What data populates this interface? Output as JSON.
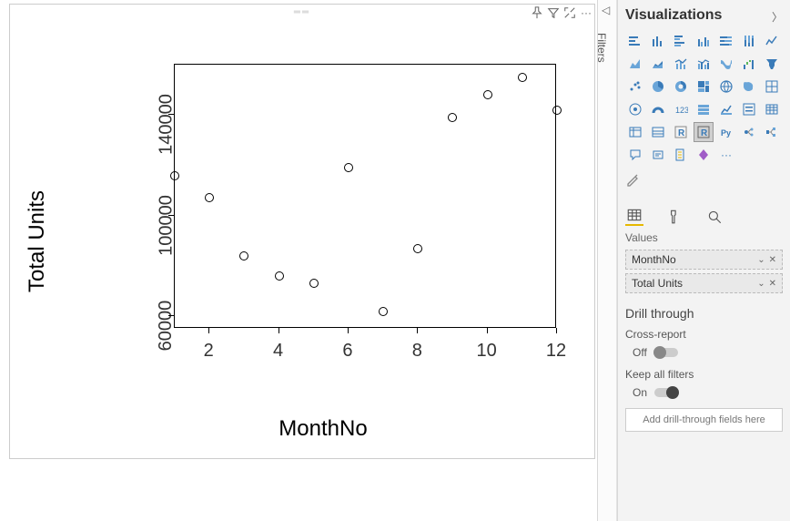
{
  "canvas": {
    "header_icons": [
      "pin-icon",
      "filter-icon",
      "focus-icon",
      "more-icon"
    ]
  },
  "filters_rail": {
    "label": "Filters"
  },
  "viz_pane": {
    "title": "Visualizations",
    "values_label": "Values",
    "fields": [
      {
        "name": "MonthNo"
      },
      {
        "name": "Total Units"
      }
    ],
    "drill": {
      "heading": "Drill through",
      "cross_label": "Cross-report",
      "cross_state": "Off",
      "keep_label": "Keep all filters",
      "keep_state": "On",
      "drop_hint": "Add drill-through fields here"
    }
  },
  "chart_data": {
    "type": "scatter",
    "xlabel": "MonthNo",
    "ylabel": "Total Units",
    "xlim": [
      1,
      12
    ],
    "ylim": [
      55000,
      160000
    ],
    "xticks": [
      2,
      4,
      6,
      8,
      10,
      12
    ],
    "yticks": [
      60000,
      100000,
      140000
    ],
    "series": [
      {
        "name": "Total Units",
        "x": [
          1,
          2,
          3,
          4,
          5,
          6,
          7,
          8,
          9,
          10,
          11,
          12
        ],
        "y": [
          116000,
          107000,
          84000,
          76000,
          73000,
          119000,
          62000,
          87000,
          139000,
          148000,
          155000,
          142000
        ]
      }
    ]
  }
}
